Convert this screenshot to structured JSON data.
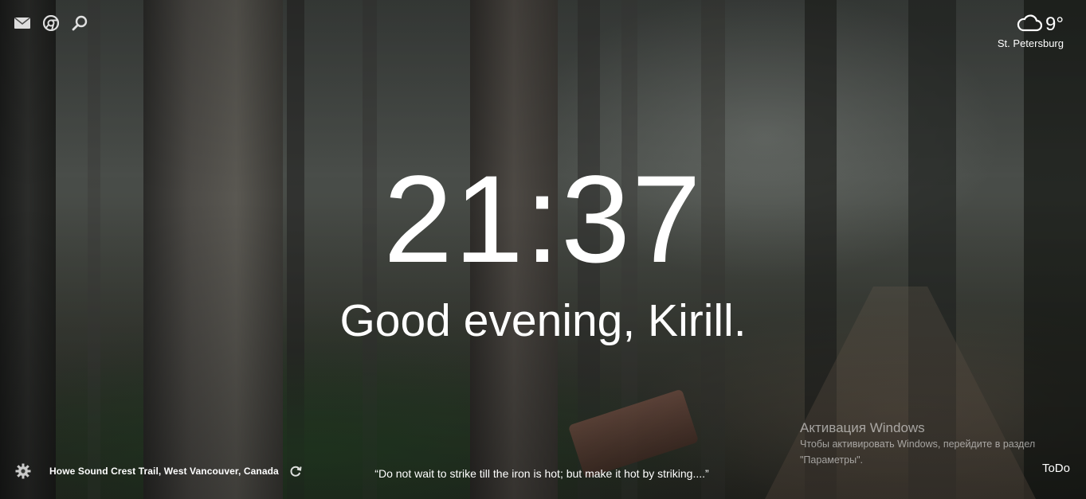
{
  "top_left": {
    "icons": [
      "mail-icon",
      "chrome-icon",
      "search-icon"
    ]
  },
  "weather": {
    "icon": "cloud-icon",
    "temperature": "9°",
    "city": "St. Petersburg"
  },
  "clock": {
    "time": "21:37"
  },
  "greeting": {
    "text": "Good evening, Kirill."
  },
  "bottom": {
    "settings_icon": "gear-icon",
    "location": "Howe Sound Crest Trail, West Vancouver, Canada",
    "refresh_icon": "refresh-icon",
    "quote": "“Do not wait to strike till the iron is hot; but make it hot by striking....”",
    "todo_label": "ToDo"
  },
  "windows_activation": {
    "title": "Активация Windows",
    "body": "Чтобы активировать Windows, перейдите в раздел \"Параметры\"."
  }
}
